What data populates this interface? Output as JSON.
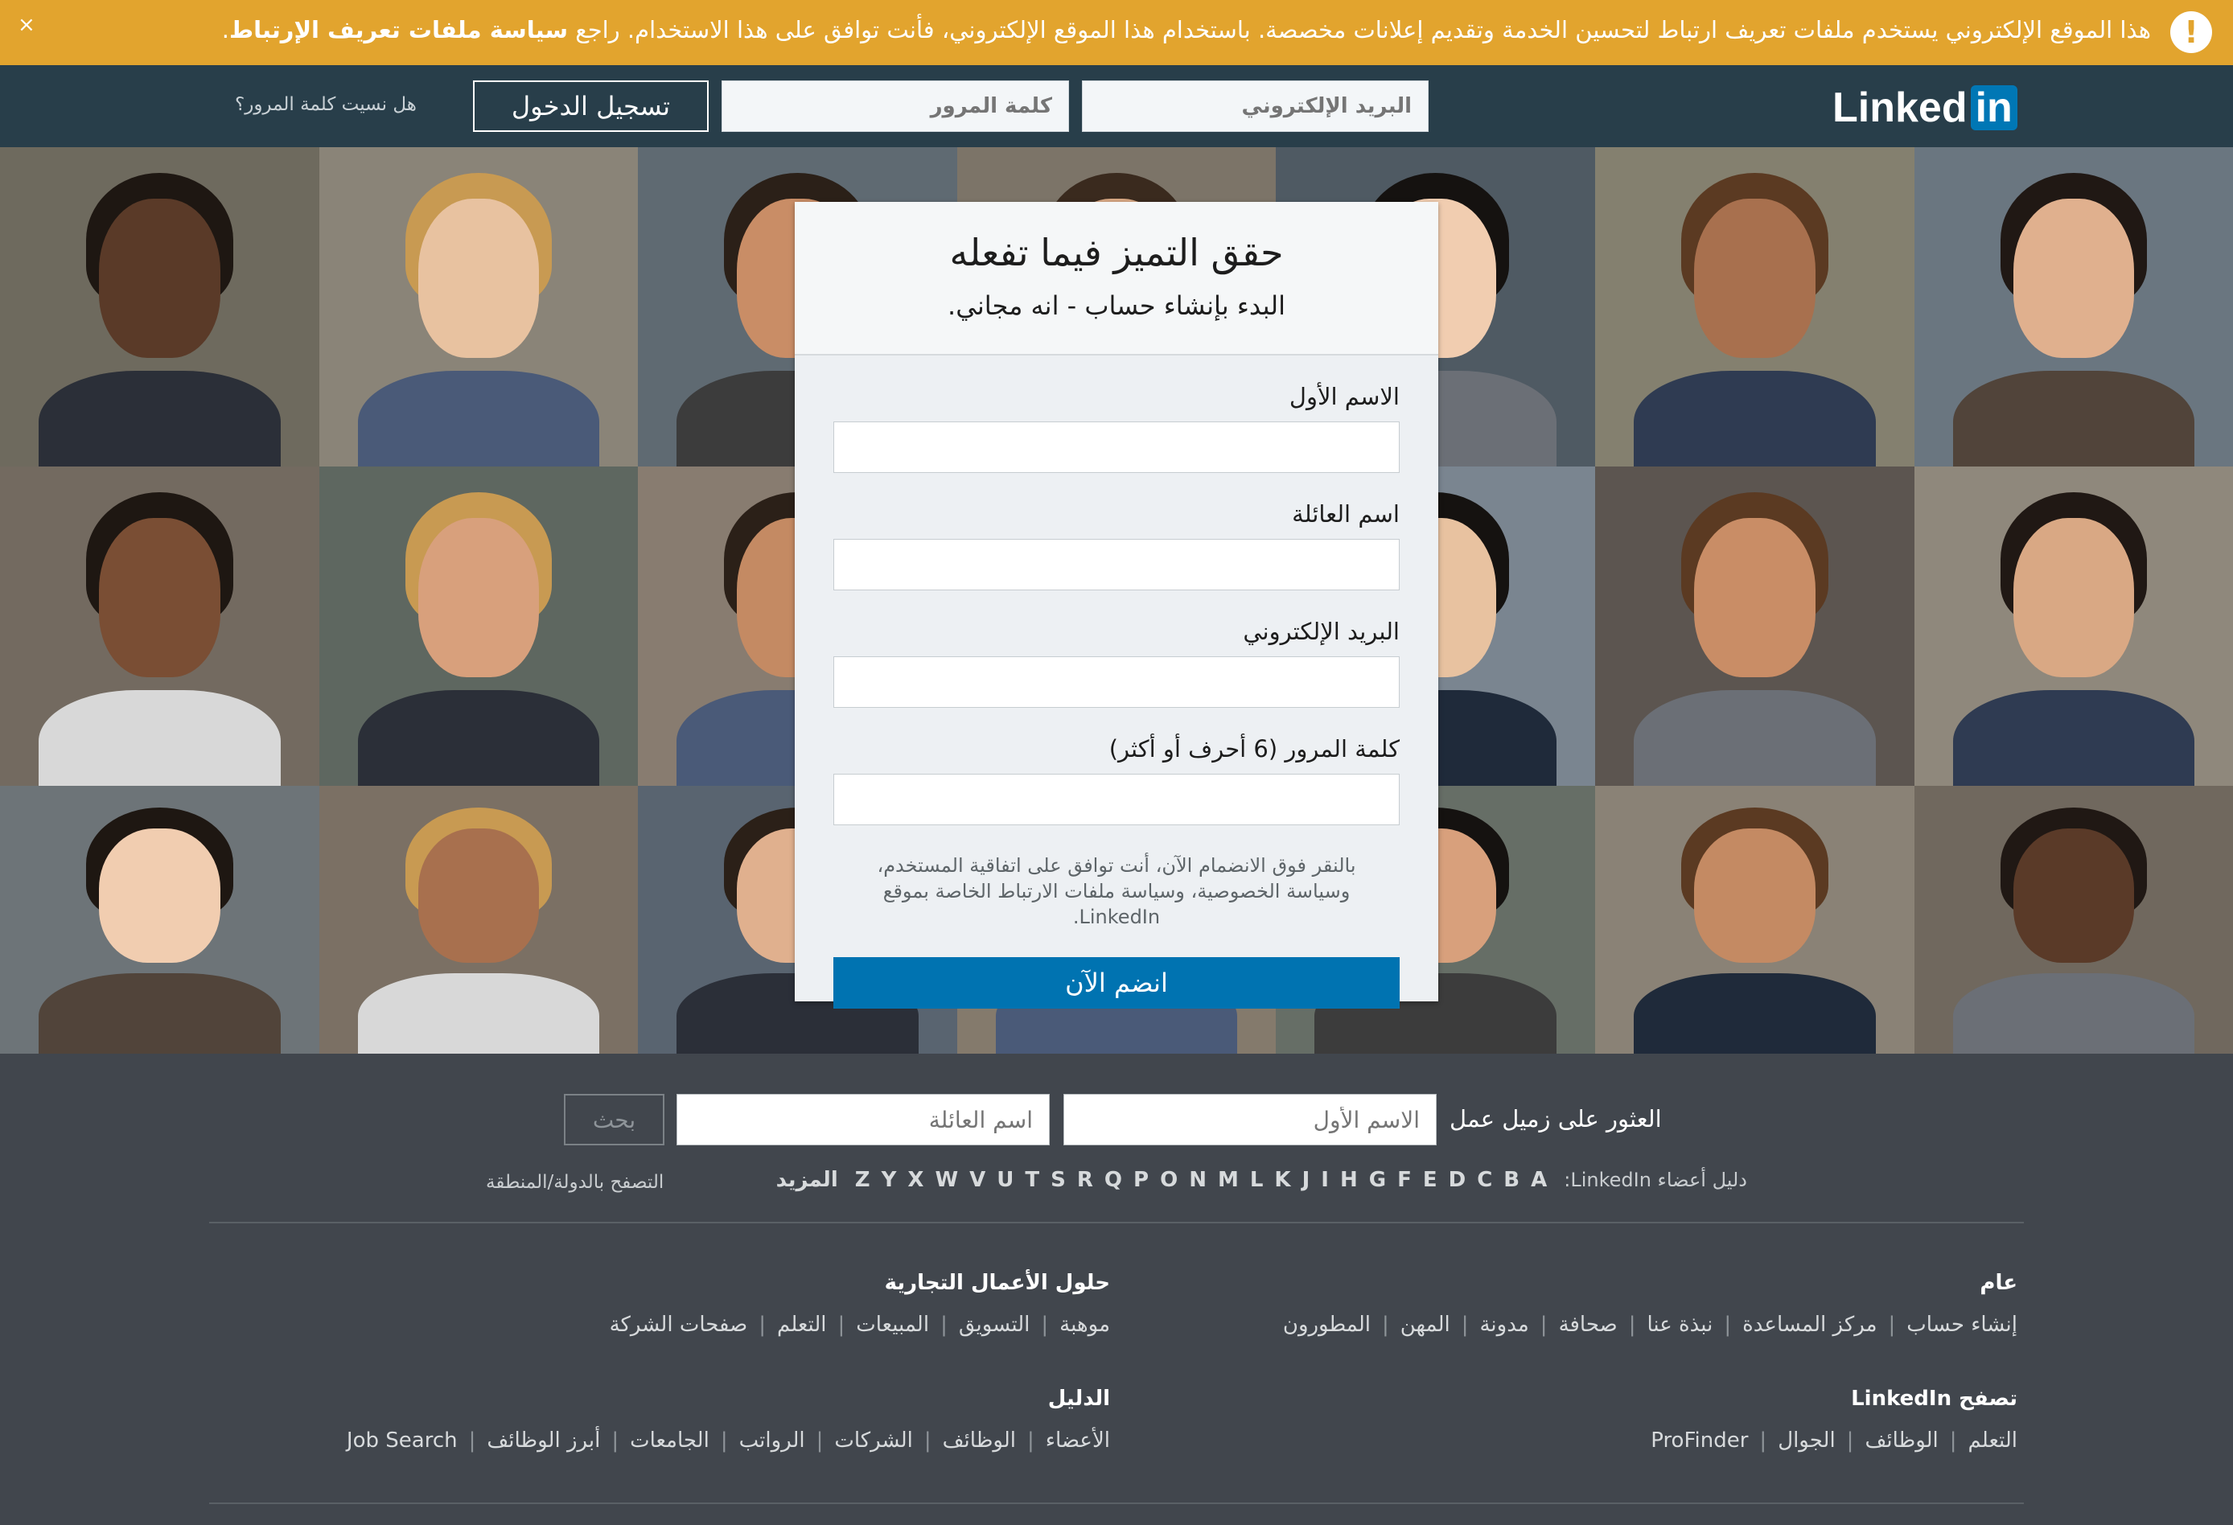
{
  "cookie_banner": {
    "message_prefix": "هذا الموقع الإلكتروني يستخدم ملفات تعريف ارتباط لتحسين الخدمة وتقديم إعلانات مخصصة. باستخدام هذا الموقع الإلكتروني، فأنت توافق على هذا الاستخدام. راجع ",
    "policy_link": "سياسة ملفات تعريف الإرتباط",
    "message_suffix": ".",
    "alert_glyph": "!",
    "close_glyph": "×",
    "color": "#e2a42e"
  },
  "header": {
    "logo_text": "Linked",
    "logo_in": "in",
    "email_placeholder": "البريد الإلكتروني",
    "password_placeholder": "كلمة المرور",
    "signin_label": "تسجيل الدخول",
    "forgot_password": "هل نسيت كلمة المرور؟",
    "bg_color": "#283e4a"
  },
  "signup": {
    "headline": "حقق التميز فيما تفعله",
    "subheadline": "البدء بإنشاء حساب - انه مجاني.",
    "first_name_label": "الاسم الأول",
    "last_name_label": "اسم العائلة",
    "email_label": "البريد الإلكتروني",
    "password_label": "كلمة المرور (6 أحرف أو أكثر)",
    "terms": "بالنقر فوق الانضمام الآن، أنت توافق على اتفاقية المستخدم، وسياسة الخصوصية، وسياسة ملفات الارتباط الخاصة بموقع LinkedIn.",
    "join_label": "انضم الآن",
    "button_color": "#0073b1"
  },
  "find_colleague": {
    "label": "العثور على زميل عمل",
    "first_placeholder": "الاسم الأول",
    "last_placeholder": "اسم العائلة",
    "search_label": "بحث"
  },
  "directory": {
    "label": "دليل أعضاء LinkedIn:",
    "letters": [
      "A",
      "B",
      "C",
      "D",
      "E",
      "F",
      "G",
      "H",
      "I",
      "J",
      "K",
      "L",
      "M",
      "N",
      "O",
      "P",
      "Q",
      "R",
      "S",
      "T",
      "U",
      "V",
      "W",
      "X",
      "Y",
      "Z"
    ],
    "more": "المزيد",
    "browse_country": "التصفح بالدولة/المنطقة"
  },
  "footer": {
    "general": {
      "title": "عام",
      "links": [
        "إنشاء حساب",
        "مركز المساعدة",
        "نبذة عنا",
        "صحافة",
        "مدونة",
        "المهن",
        "المطورون"
      ]
    },
    "business": {
      "title": "حلول الأعمال التجارية",
      "links": [
        "موهبة",
        "التسويق",
        "المبيعات",
        "التعلم",
        "صفحات الشركة"
      ]
    },
    "browse": {
      "title": "تصفح LinkedIn",
      "links": [
        "التعلم",
        "الوظائف",
        "الجوال",
        "ProFinder"
      ]
    },
    "directories": {
      "title": "الدليل",
      "links": [
        "الأعضاء",
        "الوظائف",
        "الشركات",
        "الرواتب",
        "الجامعات",
        "أبرز الوظائف",
        "Job Search"
      ]
    }
  }
}
